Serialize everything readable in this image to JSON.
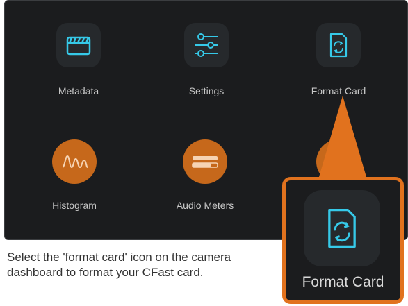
{
  "dashboard": {
    "items": [
      {
        "label": "Metadata",
        "icon": "clapperboard-icon"
      },
      {
        "label": "Settings",
        "icon": "sliders-icon"
      },
      {
        "label": "Format Card",
        "icon": "format-card-icon"
      },
      {
        "label": "Histogram",
        "icon": "histogram-wave-icon"
      },
      {
        "label": "Audio Meters",
        "icon": "audio-meters-icon"
      },
      {
        "label": "",
        "icon": "frame-guides-icon"
      }
    ]
  },
  "callout": {
    "label": "Format Card",
    "icon": "format-card-icon"
  },
  "caption": "Select the 'format card' icon on the camera dashboard to format your CFast card.",
  "colors": {
    "icon_cyan": "#36c9e8",
    "orange": "#e1721e",
    "screen_bg": "#1b1c1e",
    "tile_bg": "#26292c"
  }
}
